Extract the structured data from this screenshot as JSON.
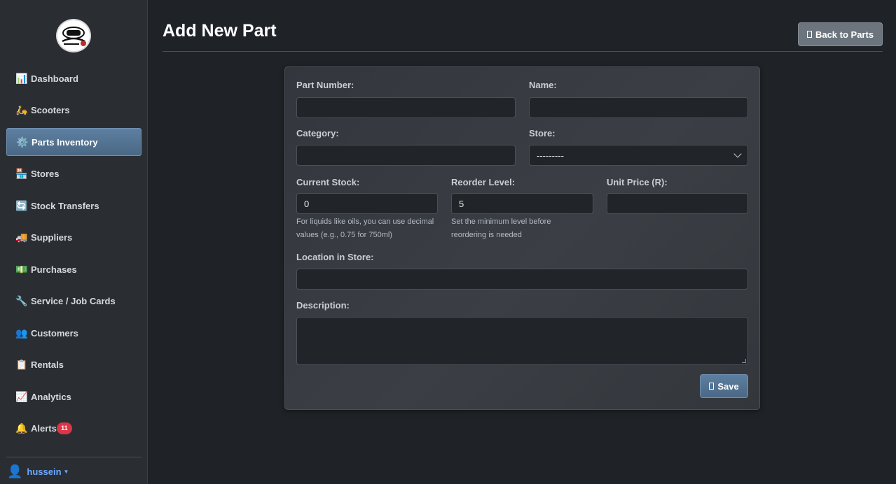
{
  "sidebar": {
    "items": [
      {
        "label": "Dashboard",
        "icon": "📊"
      },
      {
        "label": "Scooters",
        "icon": "🛵"
      },
      {
        "label": "Parts Inventory",
        "icon": "⚙️"
      },
      {
        "label": "Stores",
        "icon": "🏪"
      },
      {
        "label": "Stock Transfers",
        "icon": "🔄"
      },
      {
        "label": "Suppliers",
        "icon": "🚚"
      },
      {
        "label": "Purchases",
        "icon": "💵"
      },
      {
        "label": "Service / Job Cards",
        "icon": "🔧"
      },
      {
        "label": "Customers",
        "icon": "👥"
      },
      {
        "label": "Rentals",
        "icon": "📋"
      },
      {
        "label": "Analytics",
        "icon": "📈"
      },
      {
        "label": "Alerts",
        "icon": "🔔",
        "badge": "11"
      }
    ],
    "user": {
      "name": "hussein",
      "icon": "👤"
    }
  },
  "header": {
    "title": "Add New Part",
    "back_label": "Back to Parts"
  },
  "form": {
    "part_number_label": "Part Number:",
    "part_number_value": "",
    "name_label": "Name:",
    "name_value": "",
    "category_label": "Category:",
    "category_value": "",
    "store_label": "Store:",
    "store_value": "---------",
    "current_stock_label": "Current Stock:",
    "current_stock_value": "0",
    "current_stock_help": "For liquids like oils, you can use decimal values (e.g., 0.75 for 750ml)",
    "reorder_level_label": "Reorder Level:",
    "reorder_level_value": "5",
    "reorder_level_help": "Set the minimum level before reordering is needed",
    "unit_price_label": "Unit Price (R):",
    "unit_price_value": "",
    "location_label": "Location in Store:",
    "location_value": "",
    "description_label": "Description:",
    "description_value": "",
    "save_label": "Save"
  },
  "colors": {
    "accent": "#5d7fa0",
    "badge": "#dc3545",
    "link": "#6ea8fe"
  }
}
